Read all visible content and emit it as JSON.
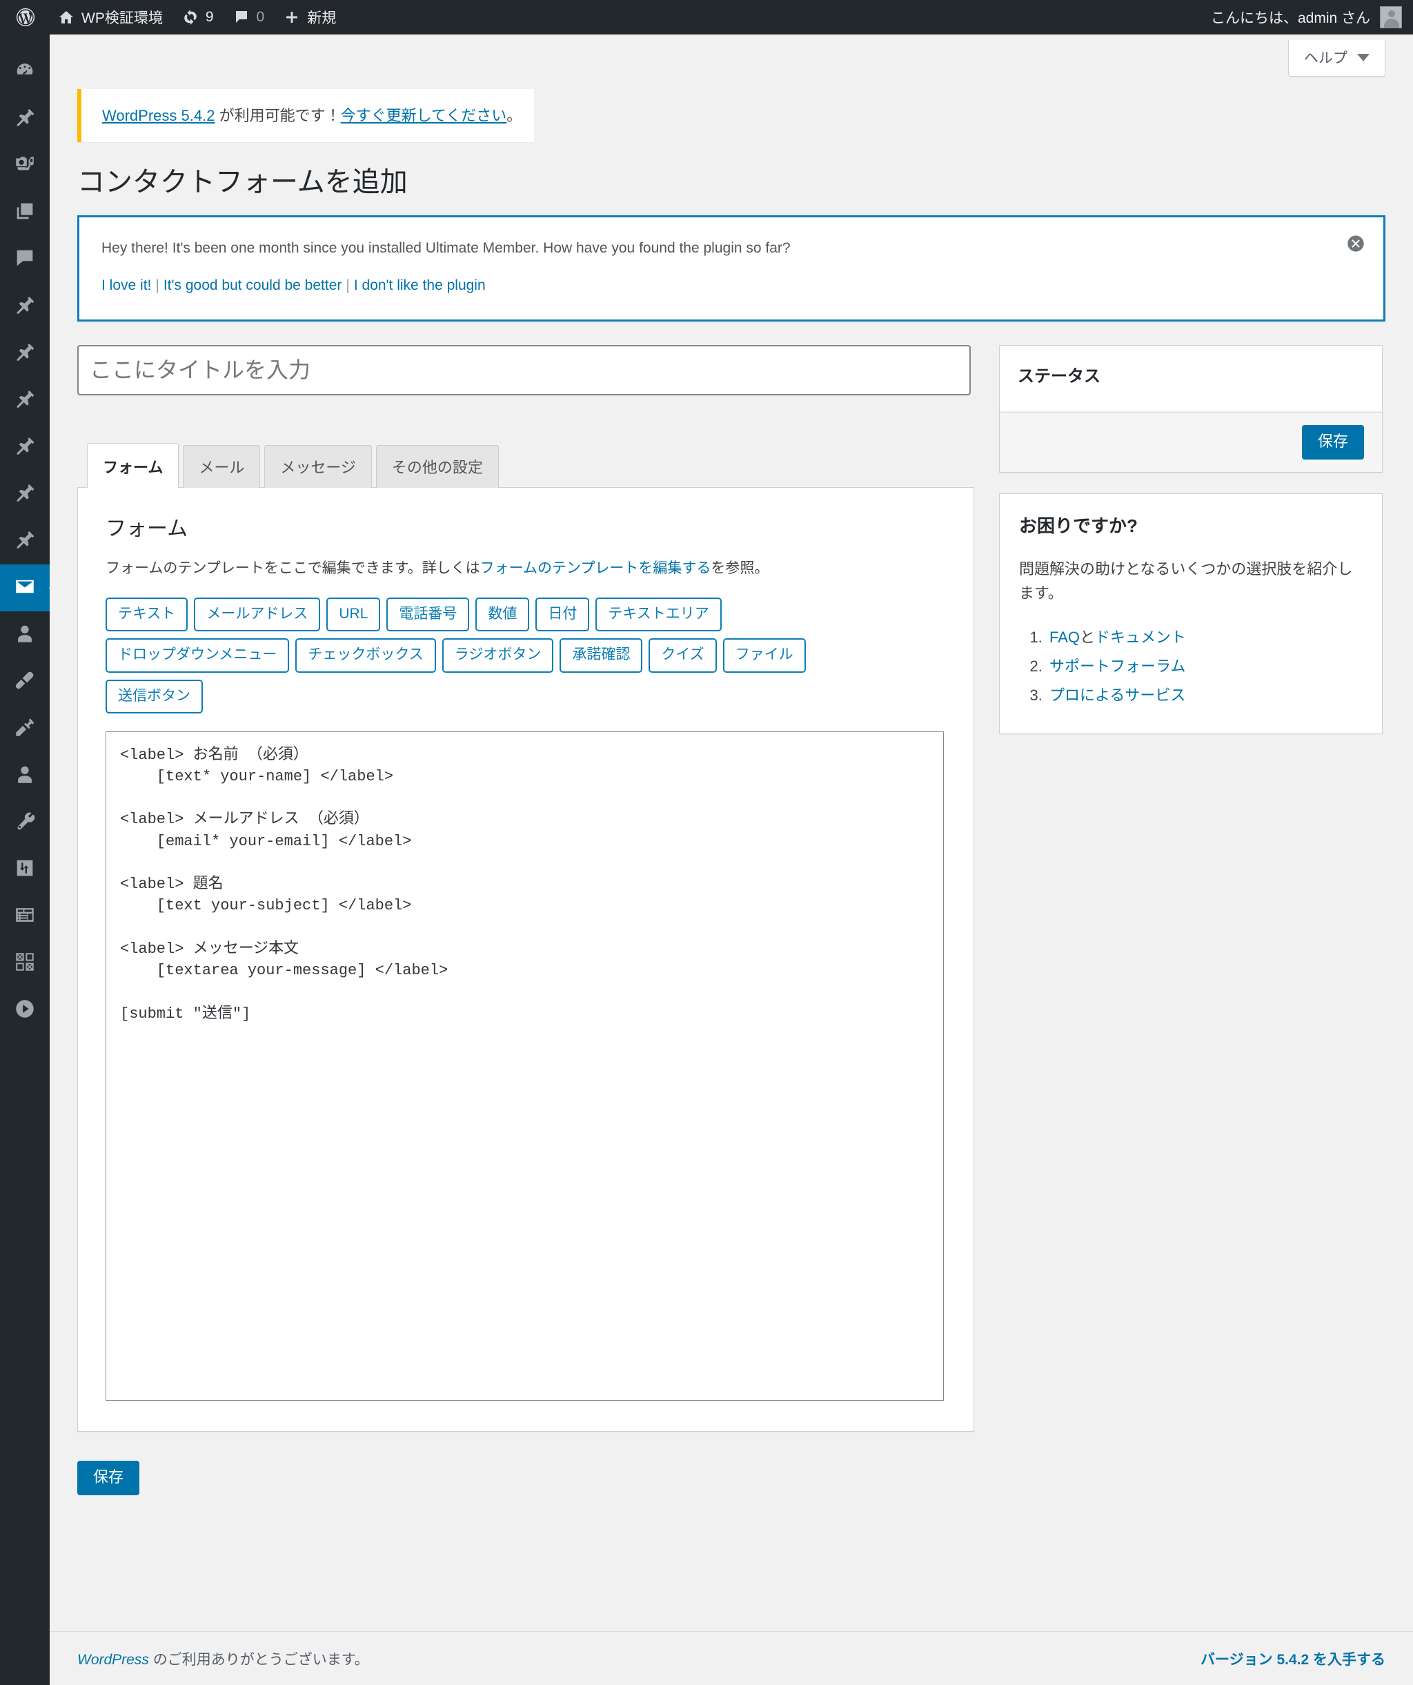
{
  "adminbar": {
    "logo_icon": "wordpress-logo-icon",
    "site_icon": "home-icon",
    "site_name": "WP検証環境",
    "updates_icon": "updates-icon",
    "updates_count": "9",
    "comments_icon": "comment-bubble-icon",
    "comments_count": "0",
    "new_icon": "plus-icon",
    "new_label": "新規",
    "greeting": "こんにちは、admin さん",
    "avatar_icon": "user-avatar-icon"
  },
  "sidebar": {
    "items": [
      {
        "name": "sidebar-item-dashboard",
        "icon": "dashboard-gauge-icon"
      },
      {
        "name": "sidebar-item-posts",
        "icon": "pin-icon"
      },
      {
        "name": "sidebar-item-media",
        "icon": "media-camera-music-icon"
      },
      {
        "name": "sidebar-item-pages",
        "icon": "pages-stack-icon"
      },
      {
        "name": "sidebar-item-comments",
        "icon": "comment-bubble-icon"
      },
      {
        "name": "sidebar-item-custom-1",
        "icon": "pin-icon"
      },
      {
        "name": "sidebar-item-custom-2",
        "icon": "pin-icon"
      },
      {
        "name": "sidebar-item-custom-3",
        "icon": "pin-icon"
      },
      {
        "name": "sidebar-item-custom-4",
        "icon": "pin-icon"
      },
      {
        "name": "sidebar-item-custom-5",
        "icon": "pin-icon"
      },
      {
        "name": "sidebar-item-custom-6",
        "icon": "pin-icon"
      },
      {
        "name": "sidebar-item-contact",
        "icon": "envelope-icon",
        "current": true
      },
      {
        "name": "sidebar-item-members",
        "icon": "user-icon"
      },
      {
        "name": "sidebar-item-appearance",
        "icon": "paintbrush-icon"
      },
      {
        "name": "sidebar-item-plugins",
        "icon": "plug-icon"
      },
      {
        "name": "sidebar-item-users",
        "icon": "user-icon"
      },
      {
        "name": "sidebar-item-tools",
        "icon": "wrench-icon"
      },
      {
        "name": "sidebar-item-settings",
        "icon": "sliders-icon"
      },
      {
        "name": "sidebar-item-forms",
        "icon": "form-table-icon"
      },
      {
        "name": "sidebar-item-grid",
        "icon": "grid-icon"
      },
      {
        "name": "sidebar-item-collapse",
        "icon": "play-circle-icon"
      }
    ]
  },
  "screen_meta": {
    "help_label": "ヘルプ",
    "caret_icon": "chevron-down-icon"
  },
  "update_notice": {
    "link_version": "WordPress 5.4.2",
    "middle": " が利用可能です！",
    "link_update": "今すぐ更新してください",
    "suffix": "。"
  },
  "page": {
    "title": "コンタクトフォームを追加"
  },
  "um_notice": {
    "message": "Hey there! It's been one month since you installed Ultimate Member. How have you found the plugin so far?",
    "option_love": "I love it!",
    "option_better": "It's good but could be better",
    "option_dislike": "I don't like the plugin",
    "divider": "|",
    "dismiss_icon": "dismiss-circle-x-icon",
    "border_color": "#0d7db5"
  },
  "title_field": {
    "placeholder": "ここにタイトルを入力",
    "value": ""
  },
  "tabs": [
    {
      "label": "フォーム",
      "name": "tab-form",
      "active": true
    },
    {
      "label": "メール",
      "name": "tab-mail",
      "active": false
    },
    {
      "label": "メッセージ",
      "name": "tab-messages",
      "active": false
    },
    {
      "label": "その他の設定",
      "name": "tab-additional-settings",
      "active": false
    }
  ],
  "form_panel": {
    "heading": "フォーム",
    "desc_prefix": "フォームのテンプレートをここで編集できます。詳しくは",
    "desc_link": "フォームのテンプレートを編集する",
    "desc_suffix": "を参照。",
    "tag_rows": [
      [
        "テキスト",
        "メールアドレス",
        "URL",
        "電話番号",
        "数値",
        "日付",
        "テキストエリア"
      ],
      [
        "ドロップダウンメニュー",
        "チェックボックス",
        "ラジオボタン",
        "承諾確認",
        "クイズ",
        "ファイル"
      ],
      [
        "送信ボタン"
      ]
    ],
    "body_value": "<label> お名前 （必須）\n    [text* your-name] </label>\n\n<label> メールアドレス （必須）\n    [email* your-email] </label>\n\n<label> 題名\n    [text your-subject] </label>\n\n<label> メッセージ本文\n    [textarea your-message] </label>\n\n[submit \"送信\"]"
  },
  "status_box": {
    "title": "ステータス",
    "save_label": "保存"
  },
  "help_box": {
    "title": "お困りですか?",
    "intro": "問題解決の助けとなるいくつかの選択肢を紹介します。",
    "item1_link_a": "FAQ",
    "item1_mid": "と",
    "item1_link_b": "ドキュメント",
    "item2_link": "サポートフォーラム",
    "item3_link": "プロによるサービス"
  },
  "bottom_save_label": "保存",
  "footer": {
    "left_link": "WordPress",
    "left_text": " のご利用ありがとうございます。",
    "right_link": "バージョン 5.4.2 を入手する"
  },
  "colors": {
    "accent": "#0073aa",
    "admin_bg": "#23282d",
    "notice_orange": "#ffb900",
    "um_blue": "#0d7db5"
  }
}
